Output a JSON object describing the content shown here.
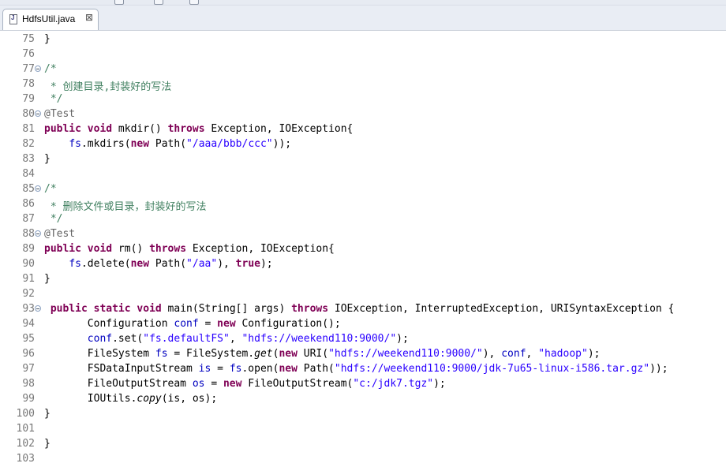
{
  "tab": {
    "filename": "HdfsUtil.java",
    "close_glyph": "⊠"
  },
  "lines": [
    {
      "n": "75",
      "fold": false,
      "t": [
        [
          "p",
          "}"
        ]
      ]
    },
    {
      "n": "76",
      "fold": false,
      "t": []
    },
    {
      "n": "77",
      "fold": true,
      "t": [
        [
          "cm",
          "/*"
        ]
      ]
    },
    {
      "n": "78",
      "fold": false,
      "t": [
        [
          "cm",
          " * 创建目录,封装好的写法"
        ]
      ]
    },
    {
      "n": "79",
      "fold": false,
      "t": [
        [
          "cm",
          " */"
        ]
      ]
    },
    {
      "n": "80",
      "fold": true,
      "t": [
        [
          "an",
          "@Test"
        ]
      ]
    },
    {
      "n": "81",
      "fold": false,
      "t": [
        [
          "kw",
          "public"
        ],
        [
          "p",
          " "
        ],
        [
          "kw",
          "void"
        ],
        [
          "p",
          " mkdir() "
        ],
        [
          "kw",
          "throws"
        ],
        [
          "p",
          " Exception, IOException{"
        ]
      ]
    },
    {
      "n": "82",
      "fold": false,
      "t": [
        [
          "p",
          "    "
        ],
        [
          "fd",
          "fs"
        ],
        [
          "p",
          ".mkdirs("
        ],
        [
          "kw",
          "new"
        ],
        [
          "p",
          " Path("
        ],
        [
          "str",
          "\"/aaa/bbb/ccc\""
        ],
        [
          "p",
          "));"
        ]
      ]
    },
    {
      "n": "83",
      "fold": false,
      "t": [
        [
          "p",
          "}"
        ]
      ]
    },
    {
      "n": "84",
      "fold": false,
      "t": []
    },
    {
      "n": "85",
      "fold": true,
      "t": [
        [
          "cm",
          "/*"
        ]
      ]
    },
    {
      "n": "86",
      "fold": false,
      "t": [
        [
          "cm",
          " * 删除文件或目录，封装好的写法"
        ]
      ]
    },
    {
      "n": "87",
      "fold": false,
      "t": [
        [
          "cm",
          " */"
        ]
      ]
    },
    {
      "n": "88",
      "fold": true,
      "t": [
        [
          "an",
          "@Test"
        ]
      ]
    },
    {
      "n": "89",
      "fold": false,
      "t": [
        [
          "kw",
          "public"
        ],
        [
          "p",
          " "
        ],
        [
          "kw",
          "void"
        ],
        [
          "p",
          " rm() "
        ],
        [
          "kw",
          "throws"
        ],
        [
          "p",
          " Exception, IOException{"
        ]
      ]
    },
    {
      "n": "90",
      "fold": false,
      "t": [
        [
          "p",
          "    "
        ],
        [
          "fd",
          "fs"
        ],
        [
          "p",
          ".delete("
        ],
        [
          "kw",
          "new"
        ],
        [
          "p",
          " Path("
        ],
        [
          "str",
          "\"/aa\""
        ],
        [
          "p",
          "), "
        ],
        [
          "kw",
          "true"
        ],
        [
          "p",
          ");"
        ]
      ]
    },
    {
      "n": "91",
      "fold": false,
      "t": [
        [
          "p",
          "}"
        ]
      ]
    },
    {
      "n": "92",
      "fold": false,
      "t": []
    },
    {
      "n": "93",
      "fold": true,
      "t": [
        [
          "p",
          " "
        ],
        [
          "kw",
          "public"
        ],
        [
          "p",
          " "
        ],
        [
          "kw",
          "static"
        ],
        [
          "p",
          " "
        ],
        [
          "kw",
          "void"
        ],
        [
          "p",
          " main(String[] args) "
        ],
        [
          "kw",
          "throws"
        ],
        [
          "p",
          " IOException, InterruptedException, URISyntaxException {"
        ]
      ]
    },
    {
      "n": "94",
      "fold": false,
      "t": [
        [
          "p",
          "       Configuration "
        ],
        [
          "fd",
          "conf"
        ],
        [
          "p",
          " = "
        ],
        [
          "kw",
          "new"
        ],
        [
          "p",
          " Configuration();"
        ]
      ]
    },
    {
      "n": "95",
      "fold": false,
      "t": [
        [
          "p",
          "       "
        ],
        [
          "fd",
          "conf"
        ],
        [
          "p",
          ".set("
        ],
        [
          "str",
          "\"fs.defaultFS\""
        ],
        [
          "p",
          ", "
        ],
        [
          "str",
          "\"hdfs://weekend110:9000/\""
        ],
        [
          "p",
          ");"
        ]
      ]
    },
    {
      "n": "96",
      "fold": false,
      "t": [
        [
          "p",
          "       FileSystem "
        ],
        [
          "fd",
          "fs"
        ],
        [
          "p",
          " = FileSystem."
        ],
        [
          "it",
          "get"
        ],
        [
          "p",
          "("
        ],
        [
          "kw",
          "new"
        ],
        [
          "p",
          " URI("
        ],
        [
          "str",
          "\"hdfs://weekend110:9000/\""
        ],
        [
          "p",
          "), "
        ],
        [
          "fd",
          "conf"
        ],
        [
          "p",
          ", "
        ],
        [
          "str",
          "\"hadoop\""
        ],
        [
          "p",
          ");"
        ]
      ]
    },
    {
      "n": "97",
      "fold": false,
      "t": [
        [
          "p",
          "       FSDataInputStream "
        ],
        [
          "fd",
          "is"
        ],
        [
          "p",
          " = "
        ],
        [
          "fd",
          "fs"
        ],
        [
          "p",
          ".open("
        ],
        [
          "kw",
          "new"
        ],
        [
          "p",
          " Path("
        ],
        [
          "str",
          "\"hdfs://weekend110:9000/jdk-7u65-linux-i586.tar.gz\""
        ],
        [
          "p",
          "));"
        ]
      ]
    },
    {
      "n": "98",
      "fold": false,
      "t": [
        [
          "p",
          "       FileOutputStream "
        ],
        [
          "fd",
          "os"
        ],
        [
          "p",
          " = "
        ],
        [
          "kw",
          "new"
        ],
        [
          "p",
          " FileOutputStream("
        ],
        [
          "str",
          "\"c:/jdk7.tgz\""
        ],
        [
          "p",
          ");"
        ]
      ]
    },
    {
      "n": "99",
      "fold": false,
      "t": [
        [
          "p",
          "       IOUtils."
        ],
        [
          "it",
          "copy"
        ],
        [
          "p",
          "(is, os);"
        ]
      ]
    },
    {
      "n": "100",
      "fold": false,
      "t": [
        [
          "p",
          "}"
        ]
      ]
    },
    {
      "n": "101",
      "fold": false,
      "t": []
    },
    {
      "n": "102",
      "fold": false,
      "t": [
        [
          "p",
          "}"
        ]
      ]
    },
    {
      "n": "103",
      "fold": false,
      "t": []
    }
  ],
  "colors": {
    "keyword": "#7f0055",
    "string": "#2a00ff",
    "comment": "#3f7f5f",
    "annotation": "#646464",
    "field": "#0000c0",
    "line_number": "#787878"
  }
}
